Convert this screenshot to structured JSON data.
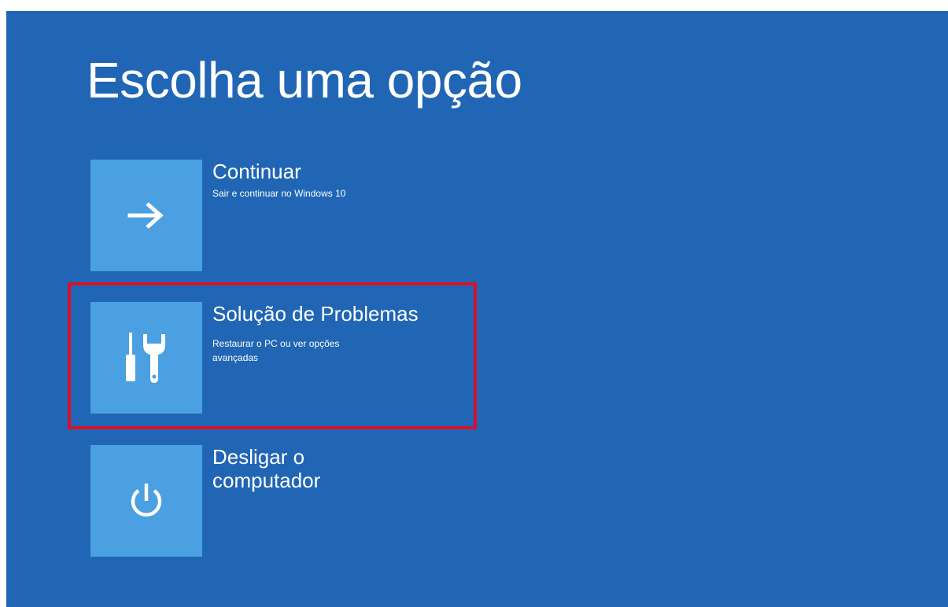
{
  "page": {
    "title": "Escolha uma opção",
    "background_color": "#2066b5",
    "tile_color": "#4aa0e0",
    "highlight_color": "#d8102a"
  },
  "options": [
    {
      "title": "Continuar",
      "description": "Sair e continuar no Windows 10",
      "icon": "arrow-right-icon"
    },
    {
      "title": "Solução de Problemas",
      "description": "Restaurar o PC ou ver opções avançadas",
      "icon": "tools-icon",
      "highlighted": true
    },
    {
      "title": "Desligar o computador",
      "description": "",
      "icon": "power-icon"
    }
  ]
}
